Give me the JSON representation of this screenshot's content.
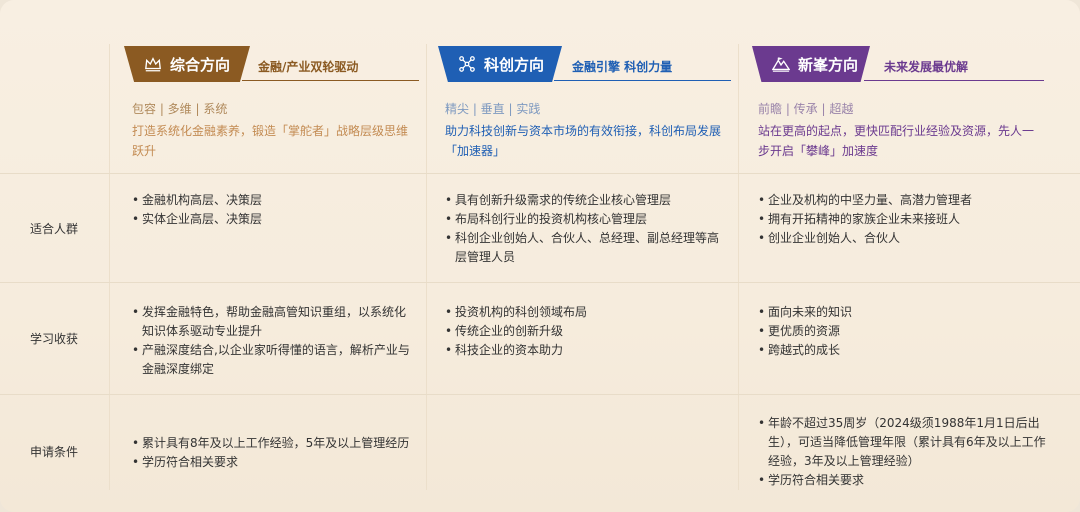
{
  "columns": [
    {
      "title": "综合方向",
      "icon": "crown-icon",
      "slogan": "金融/产业双轮驱动",
      "tags": "包容 | 多维 | 系统",
      "desc": "打造系统化金融素养，锻造「掌舵者」战略层级思维跃升",
      "color": "#8b5a22",
      "desc_color": "#c38b52"
    },
    {
      "title": "科创方向",
      "icon": "network-icon",
      "slogan": "金融引擎 科创力量",
      "tags": "精尖 | 垂直 | 实践",
      "desc": "助力科技创新与资本市场的有效衔接，科创布局发展「加速器」",
      "color": "#1f5fb4",
      "desc_color": "#1f5fb4"
    },
    {
      "title": "新峯方向",
      "icon": "mountain-icon",
      "slogan": "未来发展最优解",
      "tags": "前瞻 | 传承 | 超越",
      "desc": "站在更高的起点，更快匹配行业经验及资源，先人一步开启「攀峰」加速度",
      "color": "#6b3a8f",
      "desc_color": "#6b3a8f"
    }
  ],
  "rows": [
    {
      "label": "适合人群",
      "cells": [
        [
          "金融机构高层、决策层",
          "实体企业高层、决策层"
        ],
        [
          "具有创新升级需求的传统企业核心管理层",
          "布局科创行业的投资机构核心管理层",
          "科创企业创始人、合伙人、总经理、副总经理等高层管理人员"
        ],
        [
          "企业及机构的中坚力量、高潜力管理者",
          "拥有开拓精神的家族企业未来接班人",
          "创业企业创始人、合伙人"
        ]
      ]
    },
    {
      "label": "学习收获",
      "cells": [
        [
          "发挥金融特色，帮助金融高管知识重组，以系统化知识体系驱动专业提升",
          "产融深度结合,以企业家听得懂的语言，解析产业与金融深度绑定"
        ],
        [
          "投资机构的科创领域布局",
          "传统企业的创新升级",
          "科技企业的资本助力"
        ],
        [
          "面向未来的知识",
          "更优质的资源",
          "跨越式的成长"
        ]
      ]
    },
    {
      "label": "申请条件",
      "cells": [
        [
          "累计具有8年及以上工作经验，5年及以上管理经历",
          "学历符合相关要求"
        ],
        [],
        [
          "年龄不超过35周岁（2024级须1988年1月1日后出生），可适当降低管理年限（累计具有6年及以上工作经验，3年及以上管理经验）",
          "学历符合相关要求"
        ]
      ]
    }
  ]
}
